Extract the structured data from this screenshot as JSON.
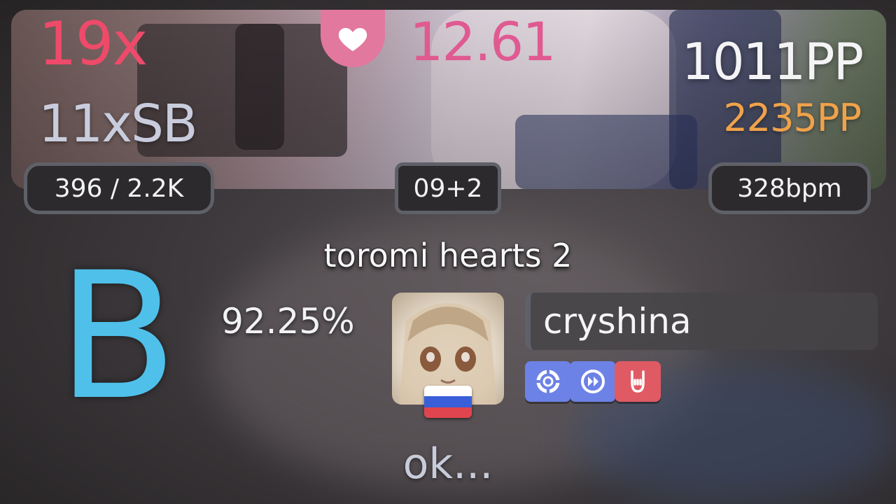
{
  "banner": {
    "combo": "19x",
    "sliderbreaks": "11xSB",
    "star_rating": "12.61",
    "pp": "1011PP",
    "max_pp": "2235PP",
    "hits": "396 / 2.2K",
    "length": "09+2",
    "bpm": "328bpm"
  },
  "score": {
    "map_title": "toromi hearts 2",
    "grade": "B",
    "accuracy": "92.25%",
    "player": "cryshina",
    "flag": "russia-flag",
    "mods": [
      {
        "icon": "ring-icon",
        "color": "#6d82e6"
      },
      {
        "icon": "fast-forward-icon",
        "color": "#6d82e6"
      },
      {
        "icon": "rock-hand-icon",
        "color": "#e05a64"
      }
    ],
    "comment": "ok..."
  },
  "colors": {
    "combo": "#ee4a6a",
    "stars": "#e05a92",
    "max_pp": "#f0a24a",
    "grade": "#4fc0ea"
  }
}
